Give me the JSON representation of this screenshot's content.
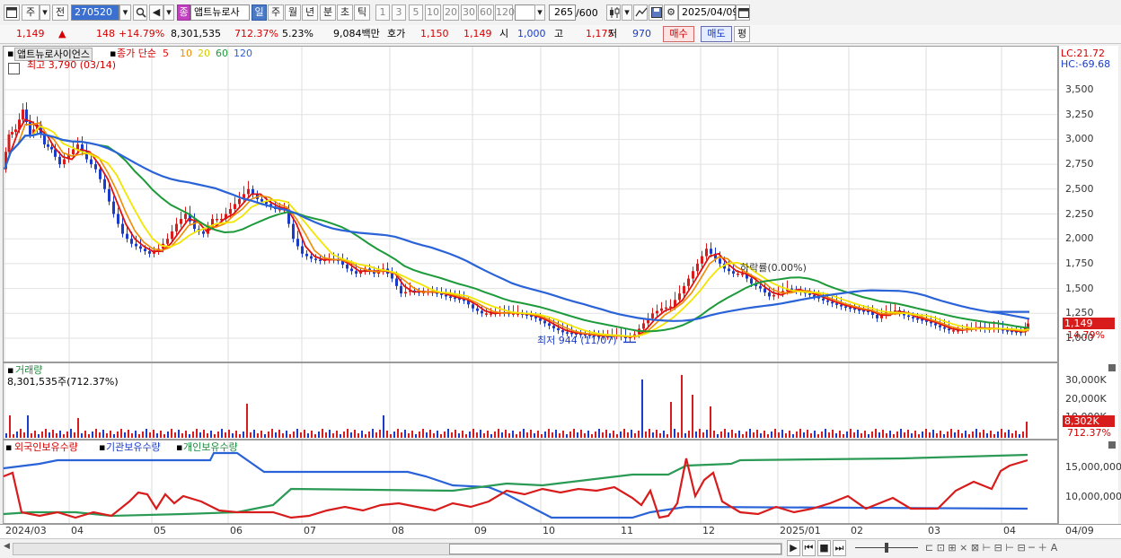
{
  "toolbar": {
    "btn_ju": "주",
    "btn_jeon": "전",
    "code": "270520",
    "name_prefix": "종",
    "stock_name": "앱트뉴로사",
    "periods": [
      "일",
      "주",
      "월",
      "년",
      "분",
      "초",
      "틱"
    ],
    "selected_period": "일",
    "ticks": [
      "1",
      "3",
      "5",
      "10",
      "20",
      "30",
      "60",
      "120"
    ],
    "count": "265",
    "count_total": "/600",
    "date": "2025/04/09"
  },
  "quote": {
    "price": "1,149",
    "change": "148",
    "change_pct": "+14.79%",
    "volume": "8,301,535",
    "volume_pct": "712.37%",
    "turnover": "5.23%",
    "amount": "9,084백만",
    "hoga_label": "호가",
    "hoga1": "1,150",
    "hoga2": "1,149",
    "open_label": "시",
    "open": "1,000",
    "high_label": "고",
    "high": "1,175",
    "low_label": "저",
    "low": "970",
    "buy_label": "매수",
    "sell_label": "매도",
    "eval_label": "평"
  },
  "price_panel": {
    "name": "앱트뉴로사이언스",
    "legend_label": "종가 단순",
    "ma": [
      {
        "name": "5",
        "color": "#e01010"
      },
      {
        "name": "10",
        "color": "#f08a00"
      },
      {
        "name": "20",
        "color": "#e6d800"
      },
      {
        "name": "60",
        "color": "#1d9a3a"
      },
      {
        "name": "120",
        "color": "#2a62d8"
      }
    ],
    "max_note": "최고 3,790 (03/14)",
    "min_note": "최저 944 (11/07)",
    "drop_note": "하락률(0.00%)",
    "lc": "LC:21.72",
    "hc": "HC:-69.68",
    "yticks": [
      "3,500",
      "3,250",
      "3,000",
      "2,750",
      "2,500",
      "2,250",
      "2,000",
      "1,750",
      "1,500",
      "1,250",
      "1,000"
    ],
    "price_tag": "1,149",
    "pct_tag": "14.79%"
  },
  "volume_panel": {
    "title": "거래량",
    "value": "8,301,535주(712.37%)",
    "yticks": [
      "30,000K",
      "20,000K",
      "10,000K"
    ],
    "tag": "8,302K",
    "tag_pct": "712.37%"
  },
  "holding_panel": {
    "items": [
      "외국인보유수량",
      "기관보유수량",
      "개인보유수량"
    ],
    "yticks": [
      "15,000,000",
      "10,000,000"
    ]
  },
  "xaxis": {
    "labels": [
      "2024/03",
      "04",
      "05",
      "06",
      "07",
      "08",
      "09",
      "10",
      "11",
      "12",
      "2025/01",
      "02",
      "03",
      "04",
      "04/09"
    ]
  },
  "colors": {
    "up": "#d81c1c",
    "down": "#1a3cc8",
    "accent": "#4a79c7"
  },
  "icons": [
    "window-icon",
    "dropdown-icon",
    "search-icon",
    "speaker-icon",
    "candle-icon",
    "line-icon",
    "save-icon",
    "gear-icon",
    "calendar-icon",
    "play-icon",
    "first-icon",
    "prev-icon",
    "stop-icon",
    "next-icon",
    "zoom-out-icon",
    "zoom-in-icon",
    "font-icon"
  ]
}
